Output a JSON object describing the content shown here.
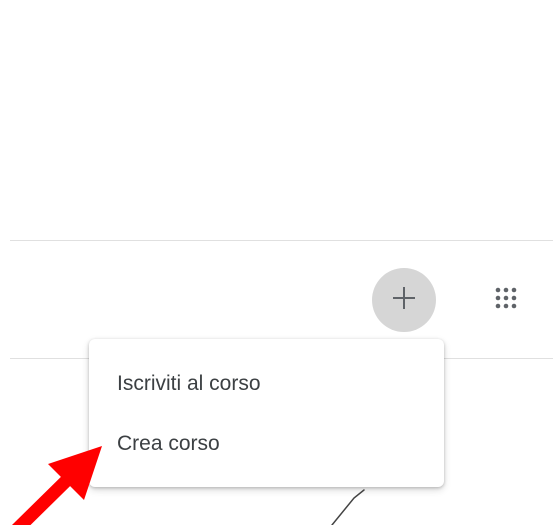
{
  "menu": {
    "items": [
      {
        "label": "Iscriviti al corso"
      },
      {
        "label": "Crea corso"
      }
    ]
  },
  "icons": {
    "add": "plus-icon",
    "apps": "apps-grid-icon",
    "annotation": "red-arrow-icon"
  },
  "colors": {
    "add_button_bg": "#d6d6d6",
    "icon": "#5f6368",
    "menu_text": "#3c4043",
    "annotation_arrow": "#ff0000"
  }
}
